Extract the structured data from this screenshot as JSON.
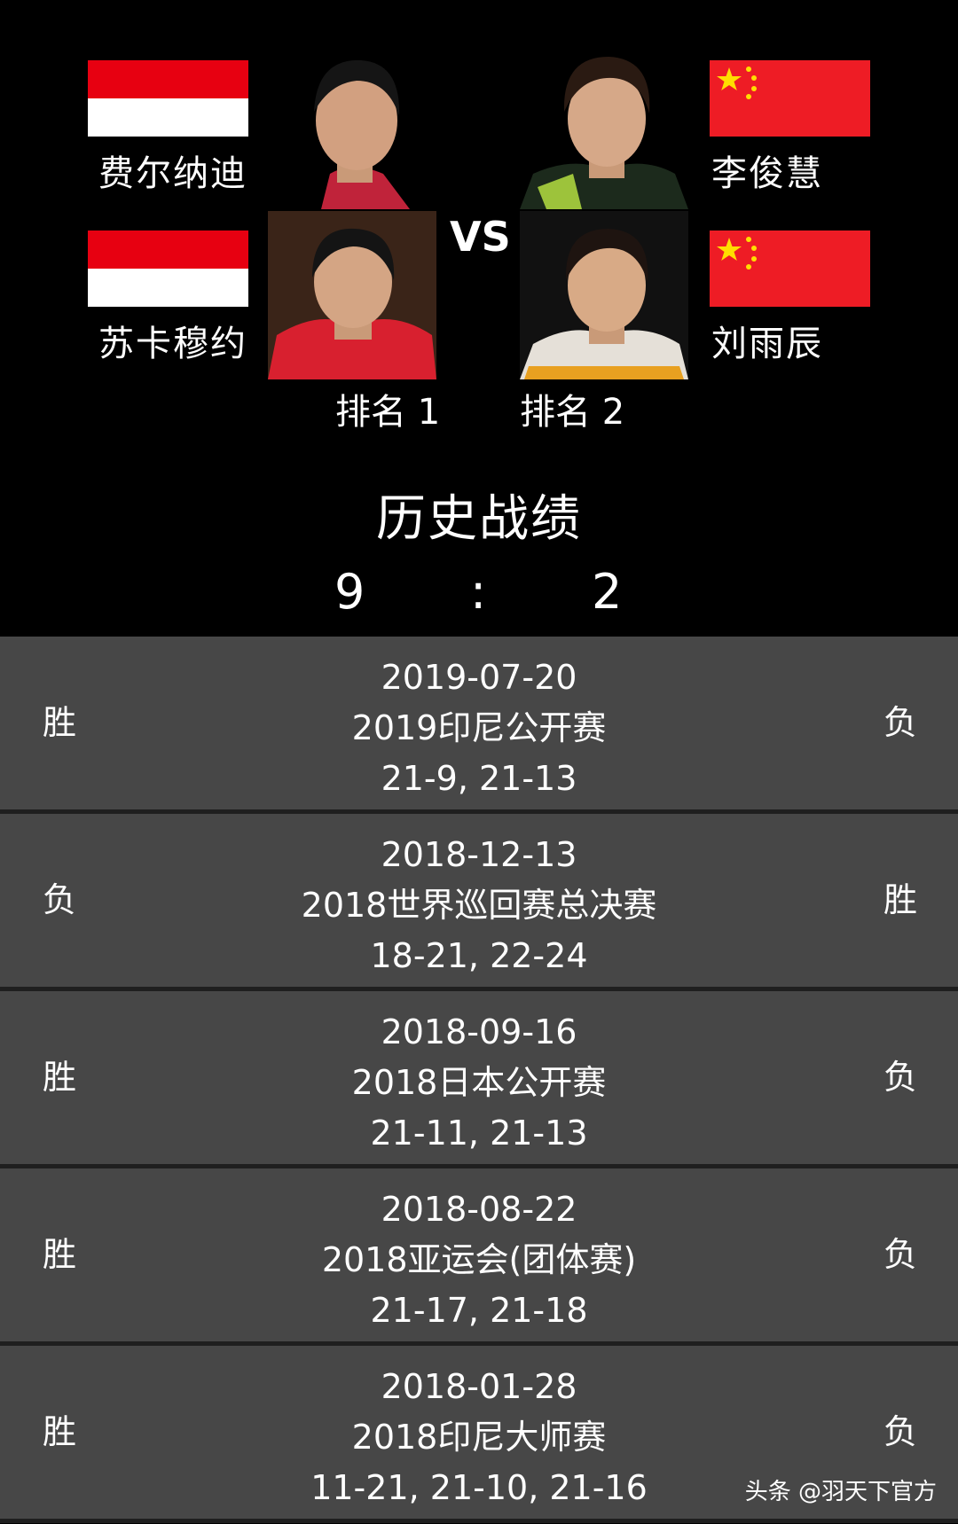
{
  "matchup": {
    "left_team": {
      "player1": {
        "name": "费尔纳迪",
        "flag": "indonesia-flag"
      },
      "player2": {
        "name": "苏卡穆约",
        "flag": "indonesia-flag"
      },
      "rank": "排名 1"
    },
    "right_team": {
      "player1": {
        "name": "李俊慧",
        "flag": "china-flag"
      },
      "player2": {
        "name": "刘雨辰",
        "flag": "china-flag"
      },
      "rank": "排名 2"
    },
    "vs_label": "VS"
  },
  "history": {
    "title": "历史战绩",
    "score_left": "9",
    "separator": ":",
    "score_right": "2"
  },
  "matches": [
    {
      "left_result": "胜",
      "date": "2019-07-20",
      "event": "2019印尼公开赛",
      "score": "21-9, 21-13",
      "right_result": "负"
    },
    {
      "left_result": "负",
      "date": "2018-12-13",
      "event": "2018世界巡回赛总决赛",
      "score": "18-21, 22-24",
      "right_result": "胜"
    },
    {
      "left_result": "胜",
      "date": "2018-09-16",
      "event": "2018日本公开赛",
      "score": "21-11, 21-13",
      "right_result": "负"
    },
    {
      "left_result": "胜",
      "date": "2018-08-22",
      "event": "2018亚运会(团体赛)",
      "score": "21-17, 21-18",
      "right_result": "负"
    },
    {
      "left_result": "胜",
      "date": "2018-01-28",
      "event": "2018印尼大师赛",
      "score": "11-21, 21-10, 21-16",
      "right_result": "负"
    }
  ],
  "watermark": "头条 @羽天下官方",
  "colors": {
    "background": "#000000",
    "row_background": "#474747",
    "indonesia_red": "#e70011",
    "china_red": "#ee1c25",
    "star_yellow": "#ffde00"
  }
}
